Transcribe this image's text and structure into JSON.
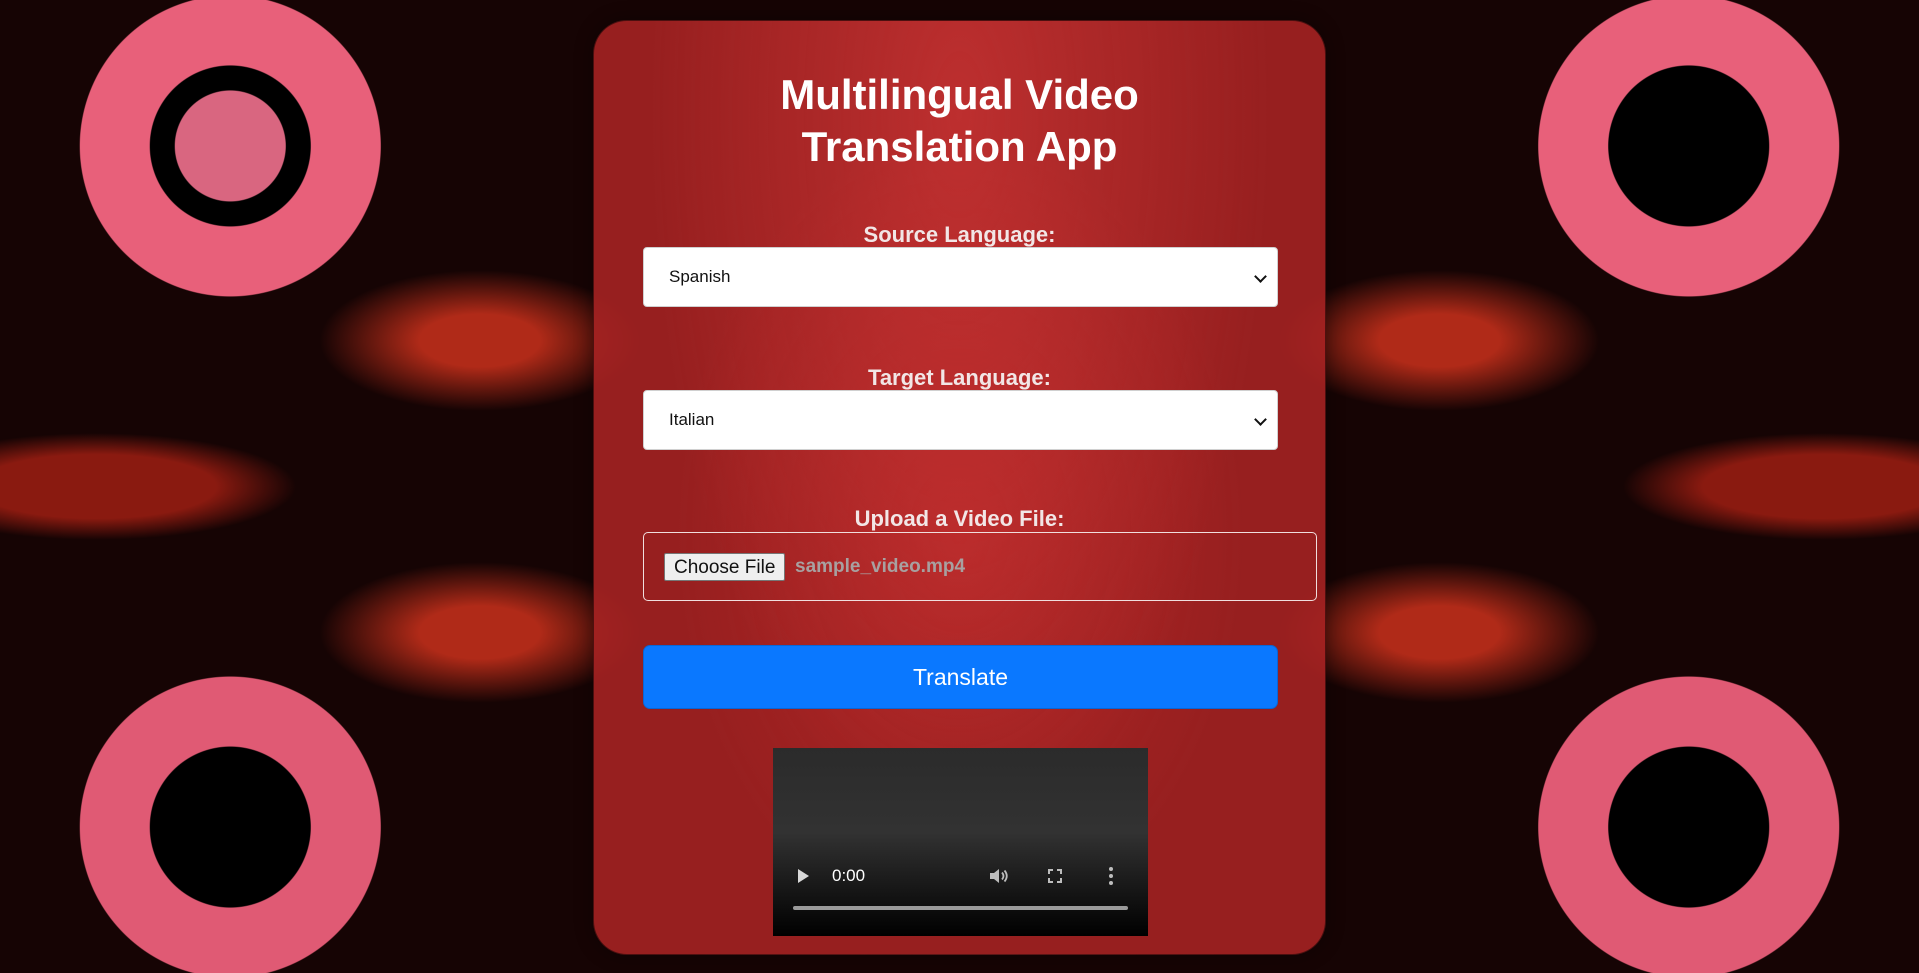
{
  "app": {
    "title": "Multilingual Video Translation App"
  },
  "source": {
    "label": "Source Language:",
    "selected": "Spanish"
  },
  "target": {
    "label": "Target Language:",
    "selected": "Italian"
  },
  "upload": {
    "label": "Upload a Video File:",
    "button_label": "Choose File",
    "file_name": "sample_video.mp4"
  },
  "actions": {
    "translate_label": "Translate"
  },
  "video": {
    "time": "0:00",
    "progress": 0
  },
  "colors": {
    "translate_button": "#0a78ff",
    "card": "#aa2323"
  },
  "icons": {
    "play": "play-icon",
    "volume": "volume-icon",
    "fullscreen": "fullscreen-icon",
    "more": "more-options-icon",
    "dropdown": "chevron-down-icon"
  }
}
